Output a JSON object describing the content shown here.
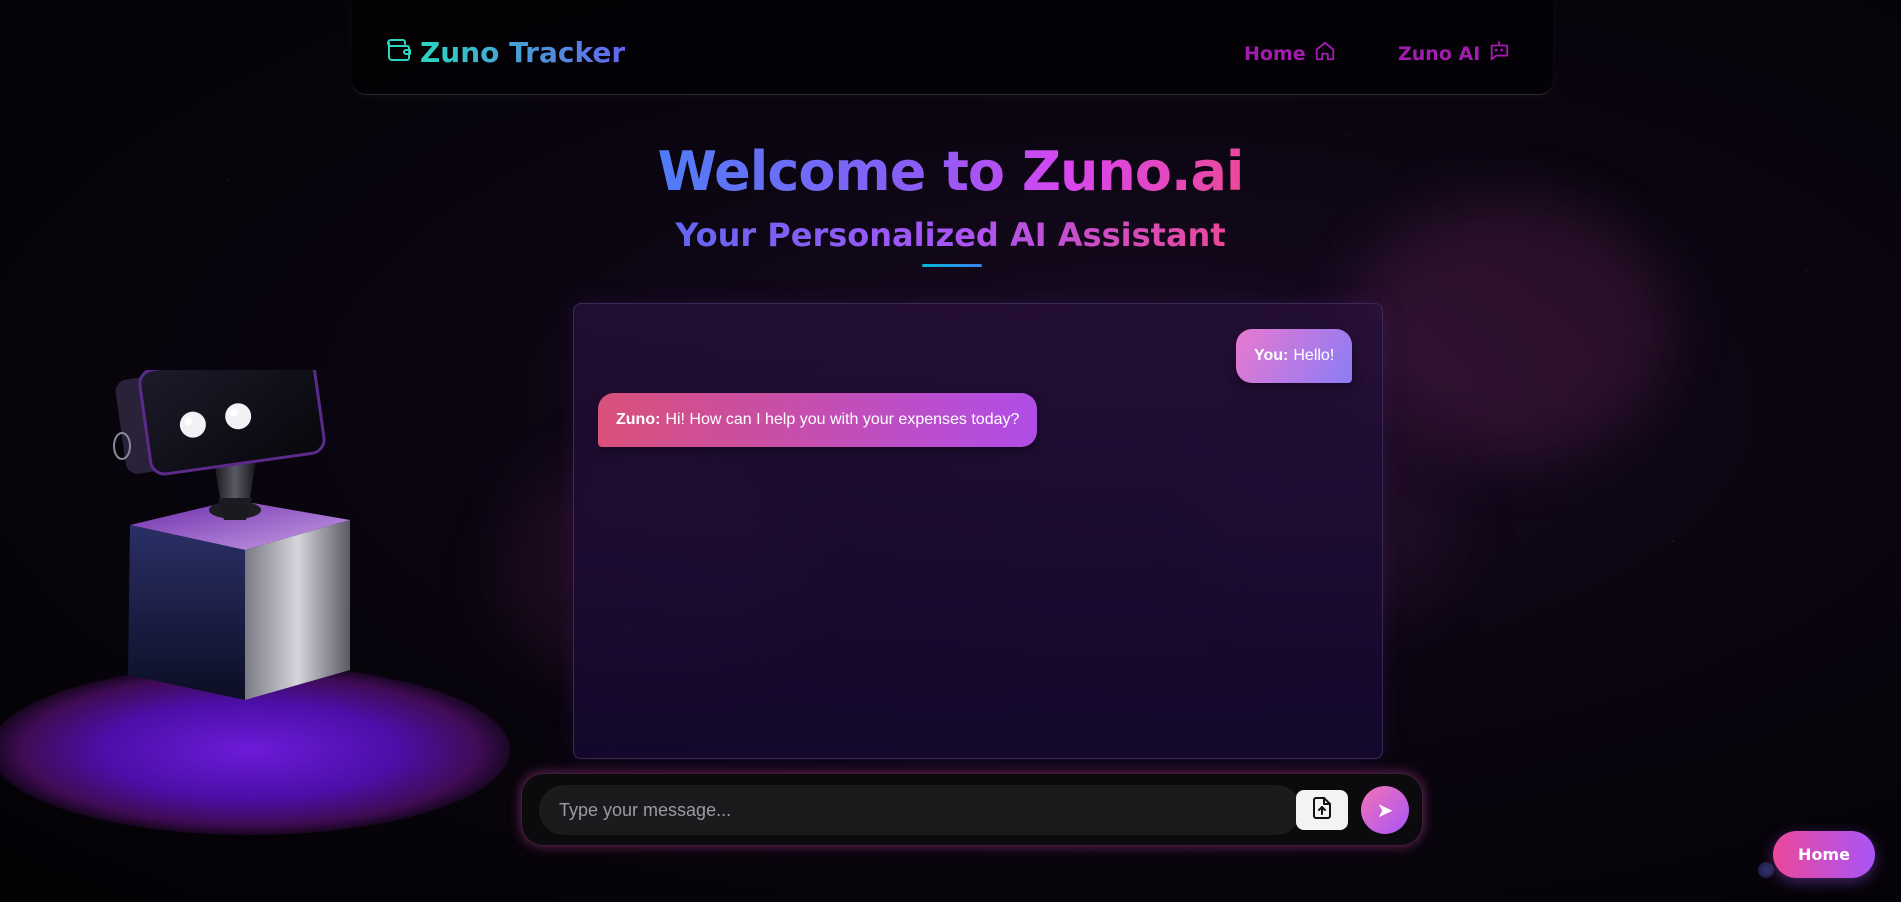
{
  "nav": {
    "brand": "Zuno Tracker",
    "links": [
      {
        "label": "Home",
        "icon": "home-icon"
      },
      {
        "label": "Zuno AI",
        "icon": "chat-bot-icon"
      }
    ]
  },
  "hero": {
    "title": "Welcome to Zuno.ai",
    "subtitle": "Your Personalized AI Assistant"
  },
  "chat": {
    "messages": [
      {
        "sender": "You:",
        "text": "Hello!",
        "role": "user"
      },
      {
        "sender": "Zuno:",
        "text": "Hi! How can I help you with your expenses today?",
        "role": "bot"
      }
    ]
  },
  "composer": {
    "placeholder": "Type your message...",
    "upload_icon": "file-upload-icon",
    "send_icon": "send-icon",
    "send_glyph": "➤"
  },
  "floating": {
    "home_label": "Home"
  },
  "colors": {
    "accent_pink": "#ec4899",
    "accent_purple": "#a855f7",
    "nav_link": "#a21caf",
    "brand_gradient_start": "#2dd4bf",
    "brand_gradient_end": "#6366f1"
  }
}
